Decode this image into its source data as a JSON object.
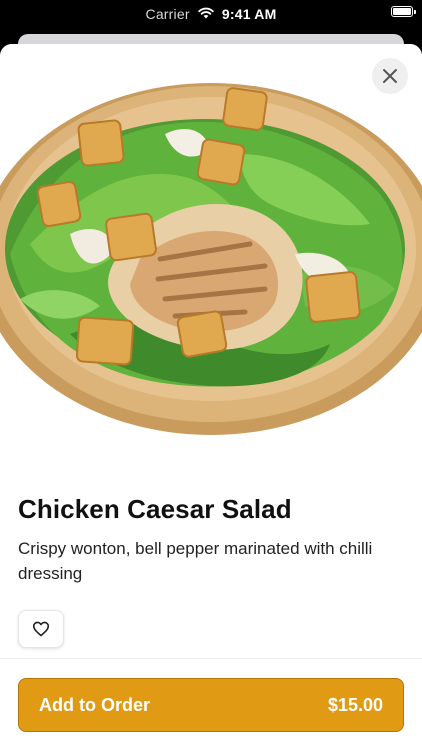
{
  "status_bar": {
    "carrier": "Carrier",
    "time": "9:41 AM"
  },
  "product": {
    "name": "Chicken Caesar Salad",
    "description": "Crispy wonton, bell pepper marinated with chilli dressing",
    "image_subject": "caesar-salad-photo"
  },
  "order_button": {
    "label": "Add to Order",
    "price": "$15.00"
  },
  "colors": {
    "accent": "#e19a14",
    "accent_border": "#b57506",
    "sheet": "#ffffff",
    "backdrop": "#000000"
  }
}
